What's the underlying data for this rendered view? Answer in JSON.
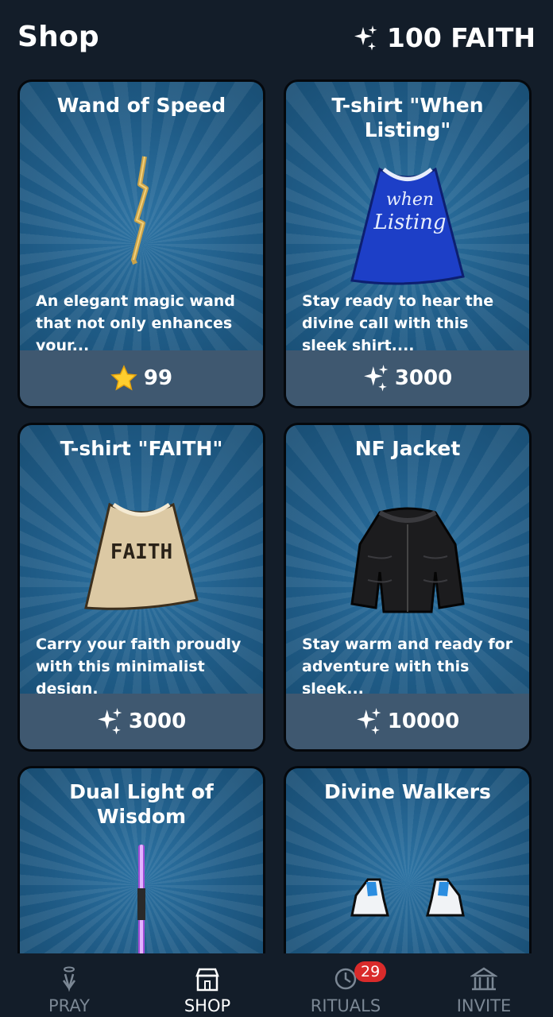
{
  "header": {
    "title": "Shop",
    "balance": "100 FAITH"
  },
  "items": [
    {
      "name": "Wand of Speed",
      "desc": "An elegant magic wand that not only enhances your...",
      "price": "99",
      "currency": "star"
    },
    {
      "name": "T-shirt \"When Listing\"",
      "desc": "Stay ready to hear the divine call with this sleek shirt,...",
      "price": "3000",
      "currency": "sparkle"
    },
    {
      "name": "T-shirt \"FAITH\"",
      "desc": "Carry your faith proudly with this minimalist design.",
      "price": "3000",
      "currency": "sparkle"
    },
    {
      "name": "NF Jacket",
      "desc": "Stay warm and ready for adventure with this sleek...",
      "price": "10000",
      "currency": "sparkle"
    },
    {
      "name": "Dual Light of Wisdom",
      "desc": "",
      "price": "",
      "currency": "sparkle"
    },
    {
      "name": "Divine Walkers",
      "desc": "",
      "price": "",
      "currency": "sparkle"
    }
  ],
  "shirt_texts": {
    "when": "when",
    "listing": "Listing",
    "faith": "FAITH"
  },
  "nav": [
    {
      "label": "PRAY",
      "icon": "pray-icon"
    },
    {
      "label": "SHOP",
      "icon": "shop-icon",
      "active": true
    },
    {
      "label": "RITUALS",
      "icon": "rituals-icon",
      "badge": "29"
    },
    {
      "label": "INVITE",
      "icon": "temple-icon"
    }
  ]
}
